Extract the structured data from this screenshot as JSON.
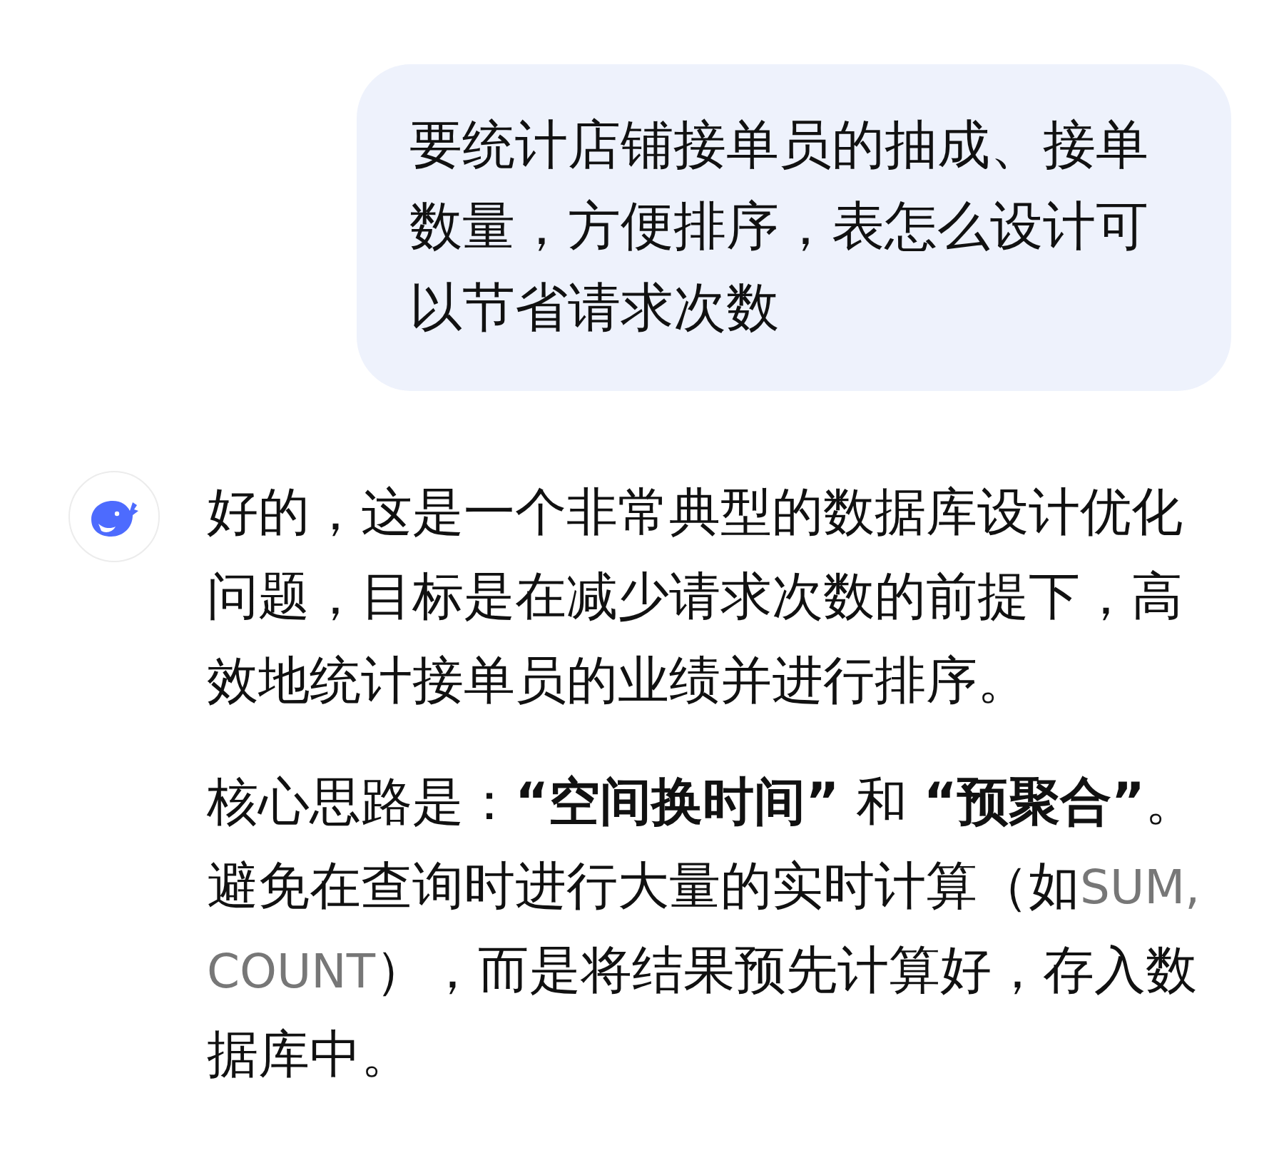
{
  "messages": [
    {
      "kind": "user",
      "text": "要统计店铺接单员的抽成、接单数量，方便排序，表怎么设计可以节省请求次数"
    },
    {
      "kind": "assistant",
      "paragraphs": [
        [
          {
            "kind": "text",
            "text": "好的，这是一个非常典型的数据库设计优化问题，目标是在减少请求次数的前提下，高效地统计接单员的业绩并进行排序。"
          }
        ],
        [
          {
            "kind": "text",
            "text": "核心思路是："
          },
          {
            "kind": "bold",
            "text": "“空间换时间”"
          },
          {
            "kind": "text",
            "text": " 和 "
          },
          {
            "kind": "bold",
            "text": "“预聚合”"
          },
          {
            "kind": "text",
            "text": "。避免在查询时进行大量的实时计算（如"
          },
          {
            "kind": "code",
            "text": "SUM, COUNT"
          },
          {
            "kind": "text",
            "text": "），而是将结果预先计算好，存入数据库中。"
          }
        ]
      ]
    }
  ]
}
